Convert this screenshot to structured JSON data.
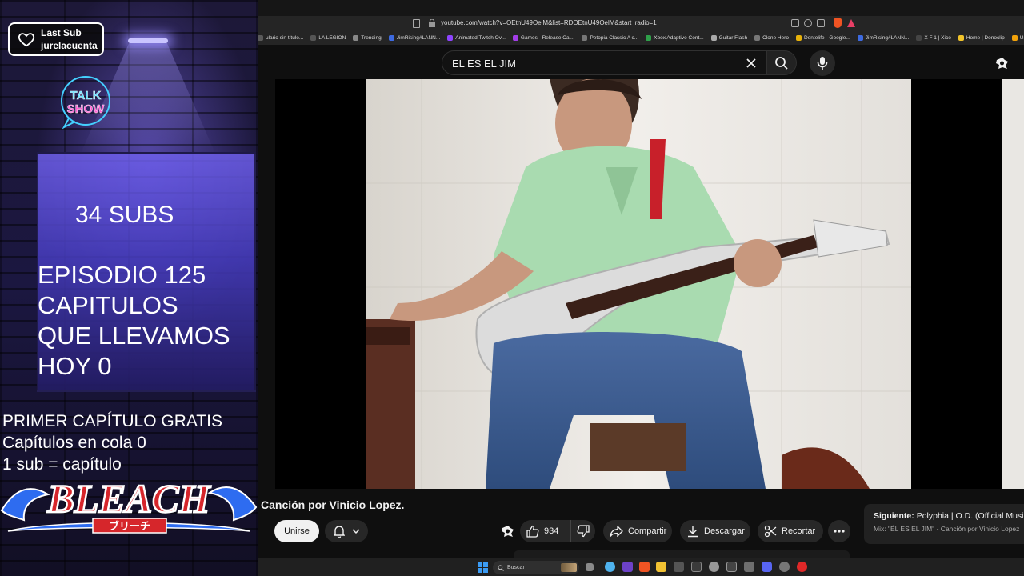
{
  "overlay": {
    "last_sub": {
      "label": "Last Sub",
      "name": "jurelacuenta"
    },
    "talk_show": {
      "line1": "TALK",
      "line2": "SHOW"
    },
    "subs_count": "34 SUBS",
    "episode": [
      "EPISODIO 125",
      "CAPITULOS",
      "QUE LLEVAMOS",
      "HOY 0"
    ],
    "info": [
      "PRIMER CAPÍTULO GRATIS",
      "Capítulos en cola 0",
      "1 sub = capítulo"
    ],
    "bleach": {
      "title": "BLEACH",
      "subtitle": "ブリーチ"
    }
  },
  "browser": {
    "url": "youtube.com/watch?v=OEtnU49OelM&list=RDOEtnU49OelM&start_radio=1",
    "bookmarks": [
      {
        "label": "ulario sin título...",
        "color": "#5a5a5a"
      },
      {
        "label": "LA LEGION",
        "color": "#555555"
      },
      {
        "label": "Trending",
        "color": "#888888"
      },
      {
        "label": "JimRising#LANN...",
        "color": "#3d6ae0"
      },
      {
        "label": "Animated Twitch Ov...",
        "color": "#8e44ff"
      },
      {
        "label": "Games - Release Cal...",
        "color": "#a33ee8"
      },
      {
        "label": "Petopia Classic A c...",
        "color": "#777777"
      },
      {
        "label": "Xbox Adaptive Cont...",
        "color": "#2fa04a"
      },
      {
        "label": "Guitar Flash",
        "color": "#aaaaaa"
      },
      {
        "label": "Clone Hero",
        "color": "#777777"
      },
      {
        "label": "Dentelife - Google...",
        "color": "#e8b20a"
      },
      {
        "label": "JimRising#LANN...",
        "color": "#3d6ae0"
      },
      {
        "label": "X F 1 | Xico",
        "color": "#444444"
      },
      {
        "label": "Home | Donoclip",
        "color": "#f2c42a"
      },
      {
        "label": "Unefon - Ilimitado",
        "color": "#f2a20a"
      }
    ]
  },
  "youtube": {
    "search_query": "EL ES EL JIM",
    "video_title": "Canción por Vinicio Lopez.",
    "join_label": "Unirse",
    "like_count": "934",
    "share_label": "Compartir",
    "download_label": "Descargar",
    "clip_label": "Recortar",
    "next": {
      "prefix": "Siguiente:",
      "title": "Polyphia | O.D. (Official Music",
      "playlist": "Mix: \"ÉL ES EL JIM\" - Canción por Vinicio Lopez"
    }
  },
  "taskbar": {
    "search_placeholder": "Buscar"
  }
}
